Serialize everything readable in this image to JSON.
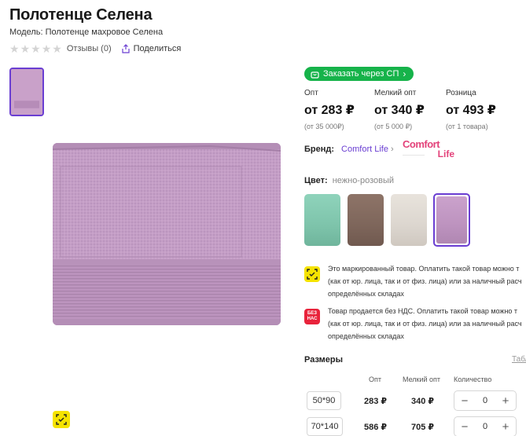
{
  "product": {
    "title": "Полотенце Селена",
    "model": "Модель: Полотенце махровое Селена",
    "reviews": "Отзывы (0)",
    "share": "Поделиться"
  },
  "purchase": {
    "sp_button": "Заказать через СП"
  },
  "prices": [
    {
      "label": "Опт",
      "value": "от 283 ₽",
      "note": "(от 35 000₽)"
    },
    {
      "label": "Мелкий опт",
      "value": "от 340 ₽",
      "note": "(от 5 000 ₽)"
    },
    {
      "label": "Розница",
      "value": "от 493 ₽",
      "note": "(от 1 товара)"
    }
  ],
  "brand": {
    "label": "Бренд:",
    "name": "Comfort Life",
    "logo_line1": "Comfort",
    "logo_line2": "Life"
  },
  "color": {
    "label": "Цвет:",
    "value": "нежно-розовый",
    "swatches": [
      "#8fcfb8",
      "#8c7266",
      "#e3ddd6",
      "#c79ac8"
    ]
  },
  "notices": [
    {
      "lines": [
        "Это маркированный товар. Оплатить такой товар можно т",
        "(как от юр. лица, так и от физ. лица) или за наличный расч",
        "определённых складах"
      ]
    },
    {
      "badge": "БЕЗ НАС",
      "lines": [
        "Товар продается без НДС. Оплатить такой товар можно т",
        "(как от юр. лица, так и от физ. лица) или за наличный расч",
        "определённых складах"
      ]
    }
  ],
  "sizes": {
    "title": "Размеры",
    "table_link": "Табл",
    "headers": {
      "opt": "Опт",
      "small_opt": "Мелкий опт",
      "quantity": "Количество"
    },
    "rows": [
      {
        "size": "50*90",
        "opt": "283 ₽",
        "small_opt": "340 ₽",
        "qty": "0"
      },
      {
        "size": "70*140",
        "opt": "586 ₽",
        "small_opt": "705 ₽",
        "qty": "0"
      }
    ]
  },
  "colors": {
    "accent": "#6a3ed2",
    "green": "#16b34a",
    "mark_yellow": "#f5e300",
    "nds_red": "#e8233b",
    "brand_pink": "#e3427a"
  }
}
